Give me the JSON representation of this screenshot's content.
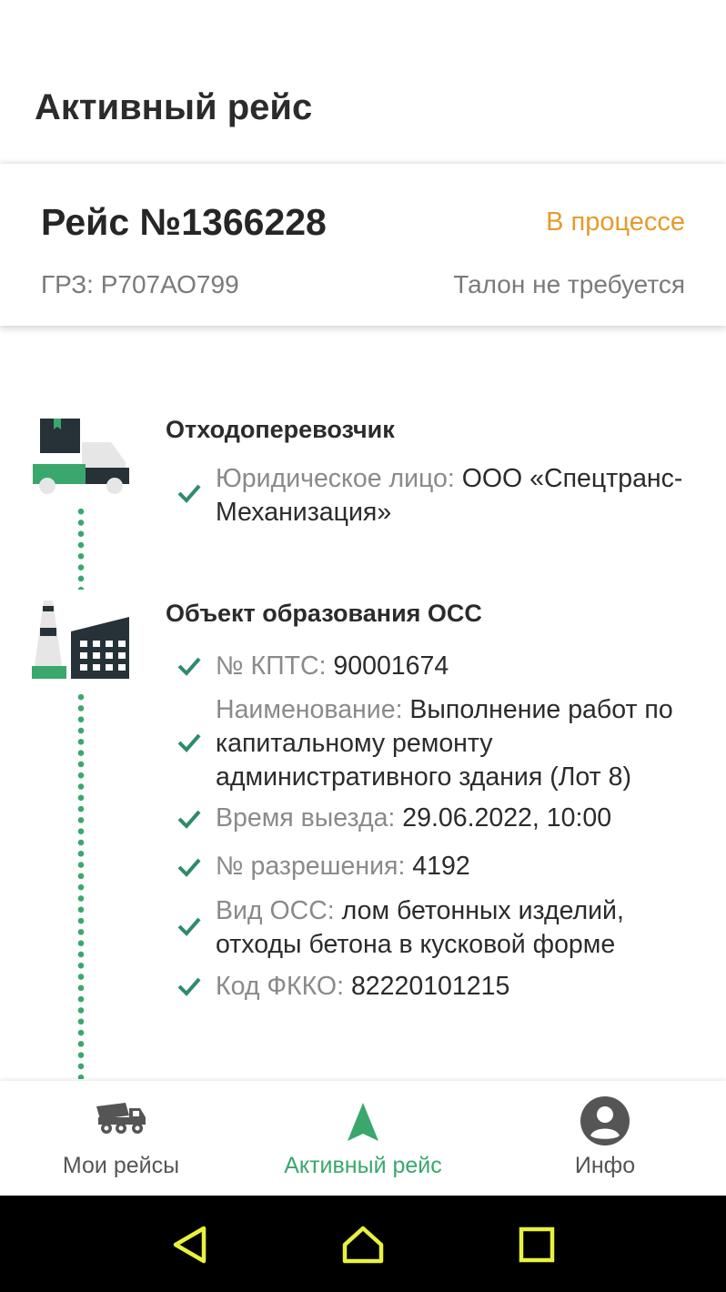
{
  "header": {
    "title": "Активный рейс"
  },
  "trip": {
    "number": "Рейс №1366228",
    "status": "В процессе",
    "grz": "ГРЗ: Р707АО799",
    "talon": "Талон не требуется"
  },
  "sections": {
    "carrier": {
      "title": "Отходоперевозчик",
      "items": [
        {
          "label": "Юридическое лицо: ",
          "value": "ООО «Спецтранс-Механизация»"
        }
      ]
    },
    "object": {
      "title": "Объект образования ОСС",
      "items": [
        {
          "label": "№ КПТС: ",
          "value": "90001674"
        },
        {
          "label": "Наименование: ",
          "value": "Выполнение работ по капитальному ремонту административного здания (Лот 8)"
        },
        {
          "label": "Время выезда: ",
          "value": "29.06.2022, 10:00"
        },
        {
          "label": "№ разрешения: ",
          "value": "4192"
        },
        {
          "label": "Вид ОСС: ",
          "value": "лом бетонных изделий, отходы бетона в кусковой форме"
        },
        {
          "label": "Код ФККО: ",
          "value": "82220101215"
        }
      ]
    }
  },
  "nav": {
    "items": [
      {
        "label": "Мои рейсы",
        "icon": "dump-truck-icon"
      },
      {
        "label": "Активный рейс",
        "icon": "navigation-arrow-icon"
      },
      {
        "label": "Инфо",
        "icon": "account-circle-icon"
      }
    ],
    "active_color": "#3aa76d",
    "inactive_color": "#555555"
  },
  "colors": {
    "accent": "#3aa76d",
    "status": "#e59b2c",
    "dark_icon": "#263238"
  }
}
